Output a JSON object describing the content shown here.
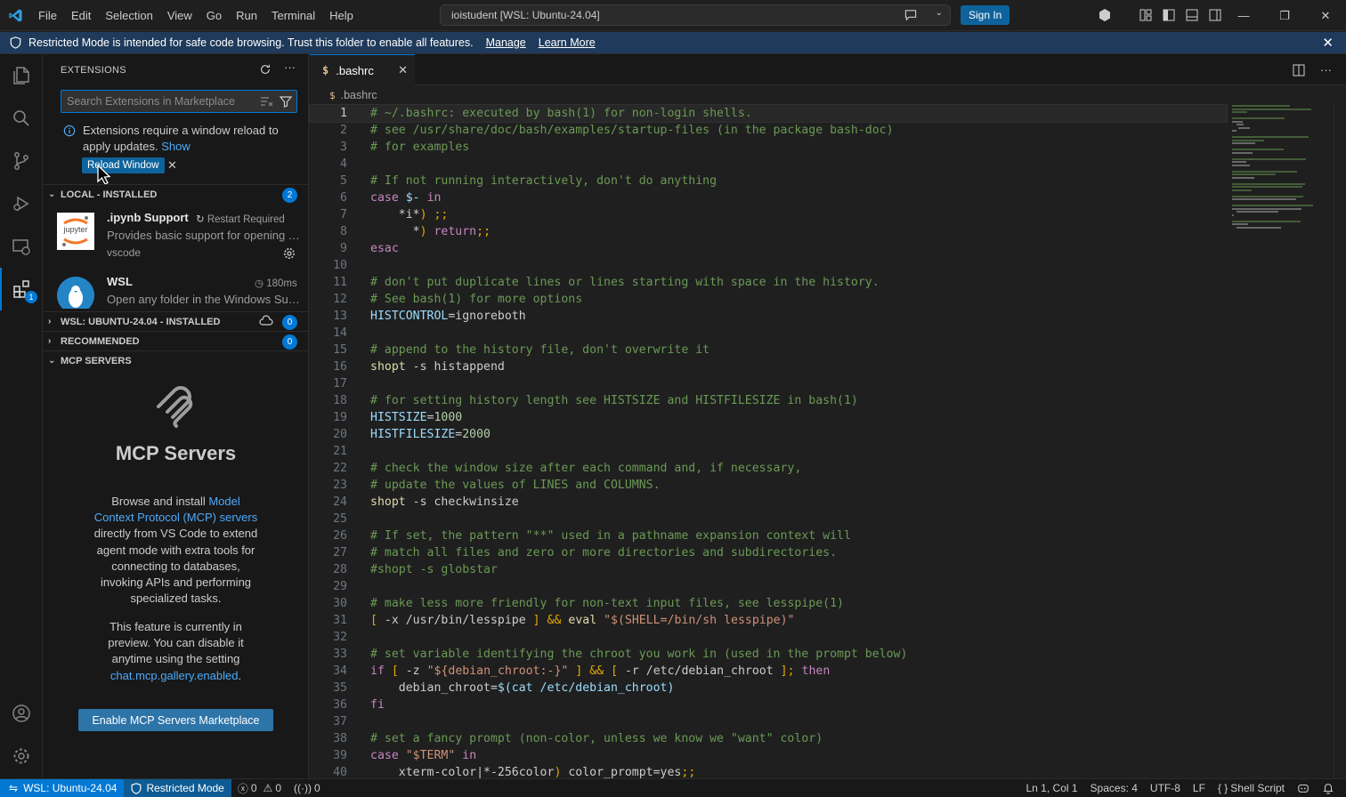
{
  "titlebar": {
    "menu": [
      "File",
      "Edit",
      "Selection",
      "View",
      "Go",
      "Run",
      "Terminal",
      "Help"
    ],
    "command_center": "ioistudent [WSL: Ubuntu-24.04]",
    "sign_in": "Sign In"
  },
  "banner": {
    "text": "Restricted Mode is intended for safe code browsing. Trust this folder to enable all features.",
    "manage": "Manage",
    "learn_more": "Learn More"
  },
  "activity_bar": {
    "extensions_badge": "1"
  },
  "sidebar": {
    "title": "EXTENSIONS",
    "search_placeholder": "Search Extensions in Marketplace",
    "notice_text": "Extensions require a window reload to apply updates.",
    "notice_link": "Show",
    "reload_button": "Reload Window",
    "sections": {
      "local": {
        "label": "LOCAL - INSTALLED",
        "count": "2"
      },
      "wsl": {
        "label": "WSL: UBUNTU-24.04 - INSTALLED",
        "count": "0"
      },
      "recommended": {
        "label": "RECOMMENDED",
        "count": "0"
      },
      "mcp": {
        "label": "MCP SERVERS"
      }
    },
    "extensions": [
      {
        "name": ".ipynb Support",
        "status": "Restart Required",
        "description": "Provides basic support for opening and reading Jupyter's .ipynb notebook files",
        "publisher": "vscode",
        "icon_label": "jupyter"
      },
      {
        "name": "WSL",
        "status": "180ms",
        "description": "Open any folder in the Windows Subsystem for Linux (WSL) and take advantage of Visual Studio Code's full feature set."
      }
    ],
    "mcp": {
      "title": "MCP Servers",
      "desc_before": "Browse and install ",
      "desc_link": "Model Context Protocol (MCP) servers",
      "desc_after": " directly from VS Code to extend agent mode with extra tools for connecting to databases, invoking APIs and performing specialized tasks.",
      "preview_before": "This feature is currently in preview. You can disable it anytime using the setting ",
      "preview_link": "chat.mcp.gallery.enabled",
      "preview_after": ".",
      "button": "Enable MCP Servers Marketplace"
    }
  },
  "editor": {
    "tab_label": ".bashrc",
    "breadcrumb": ".bashrc",
    "lines": [
      "# ~/.bashrc: executed by bash(1) for non-login shells.",
      "# see /usr/share/doc/bash/examples/startup-files (in the package bash-doc)",
      "# for examples",
      "",
      "# If not running interactively, don't do anything",
      "case $- in",
      "    *i*) ;;",
      "      *) return;;",
      "esac",
      "",
      "# don't put duplicate lines or lines starting with space in the history.",
      "# See bash(1) for more options",
      "HISTCONTROL=ignoreboth",
      "",
      "# append to the history file, don't overwrite it",
      "shopt -s histappend",
      "",
      "# for setting history length see HISTSIZE and HISTFILESIZE in bash(1)",
      "HISTSIZE=1000",
      "HISTFILESIZE=2000",
      "",
      "# check the window size after each command and, if necessary,",
      "# update the values of LINES and COLUMNS.",
      "shopt -s checkwinsize",
      "",
      "# If set, the pattern \"**\" used in a pathname expansion context will",
      "# match all files and zero or more directories and subdirectories.",
      "#shopt -s globstar",
      "",
      "# make less more friendly for non-text input files, see lesspipe(1)",
      "[ -x /usr/bin/lesspipe ] && eval \"$(SHELL=/bin/sh lesspipe)\"",
      "",
      "# set variable identifying the chroot you work in (used in the prompt below)",
      "if [ -z \"${debian_chroot:-}\" ] && [ -r /etc/debian_chroot ]; then",
      "    debian_chroot=$(cat /etc/debian_chroot)",
      "fi",
      "",
      "# set a fancy prompt (non-color, unless we know we \"want\" color)",
      "case \"$TERM\" in",
      "    xterm-color|*-256color) color_prompt=yes;;"
    ]
  },
  "statusbar": {
    "remote": "WSL: Ubuntu-24.04",
    "restricted": "Restricted Mode",
    "errors": "0",
    "warnings": "0",
    "ports": "0",
    "position": "Ln 1, Col 1",
    "spaces": "Spaces: 4",
    "encoding": "UTF-8",
    "eol": "LF",
    "language": "Shell Script"
  },
  "colors": {
    "accent": "#0078d4",
    "comment": "#6a9955",
    "keyword": "#c586c0",
    "builtin": "#dcdcaa",
    "variable": "#9cdcfe",
    "string": "#ce9178",
    "number": "#b5cea8",
    "control": "#e9a700"
  }
}
